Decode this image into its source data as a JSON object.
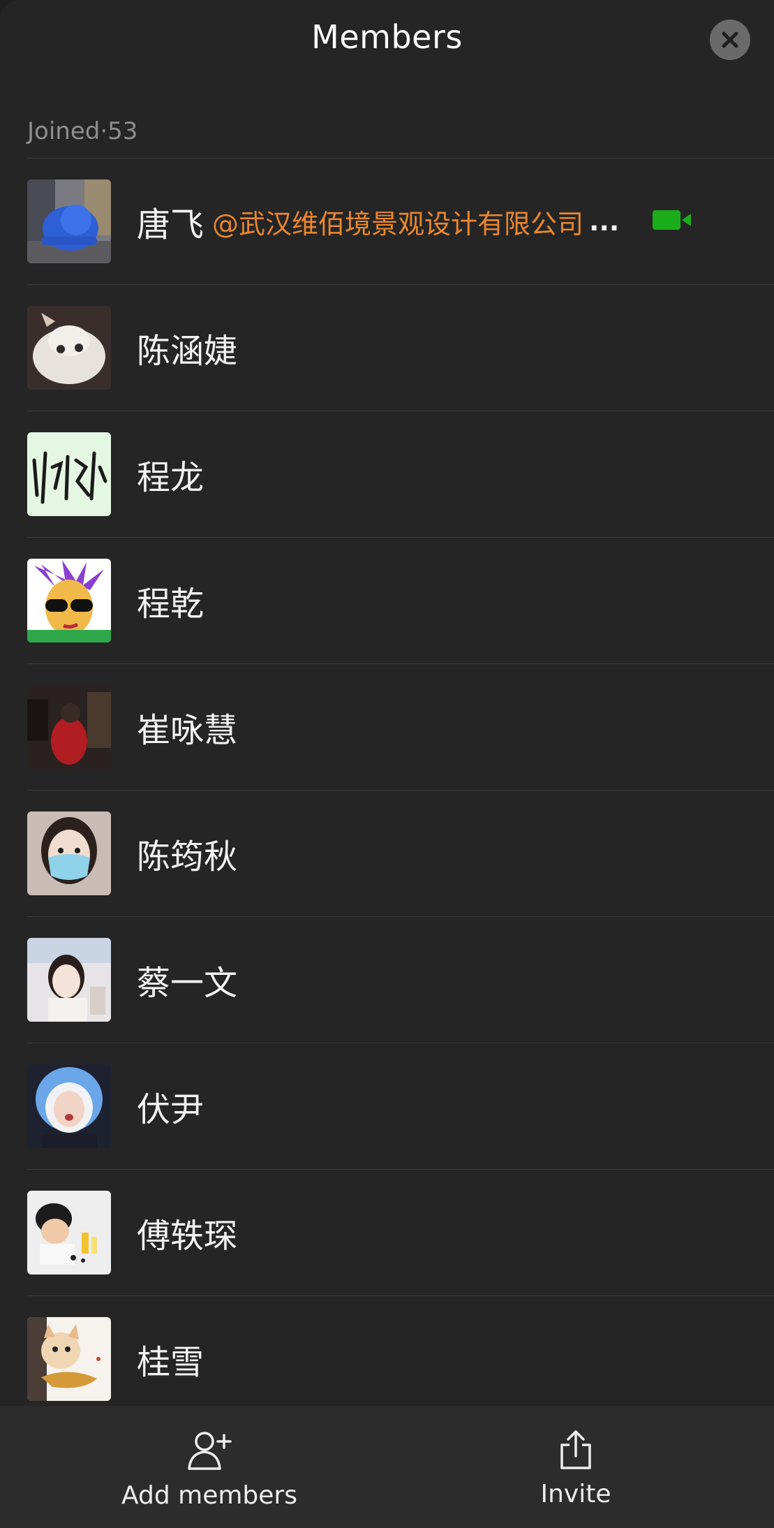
{
  "header": {
    "title": "Members",
    "close_icon": "close-icon"
  },
  "section": {
    "label": "Joined·53"
  },
  "members": [
    {
      "name": "唐飞",
      "org": "@武汉维佰境景观设计有限公司",
      "ellipsis": "...",
      "video": true
    },
    {
      "name": "陈涵婕"
    },
    {
      "name": "程龙"
    },
    {
      "name": "程乾"
    },
    {
      "name": "崔咏慧"
    },
    {
      "name": "陈筠秋"
    },
    {
      "name": "蔡一文"
    },
    {
      "name": "伏尹"
    },
    {
      "name": "傅轶琛"
    },
    {
      "name": "桂雪"
    }
  ],
  "bottom_bar": {
    "add_label": "Add members",
    "invite_label": "Invite"
  },
  "colors": {
    "accent_org": "#e9872f",
    "video_green": "#1aad19"
  }
}
